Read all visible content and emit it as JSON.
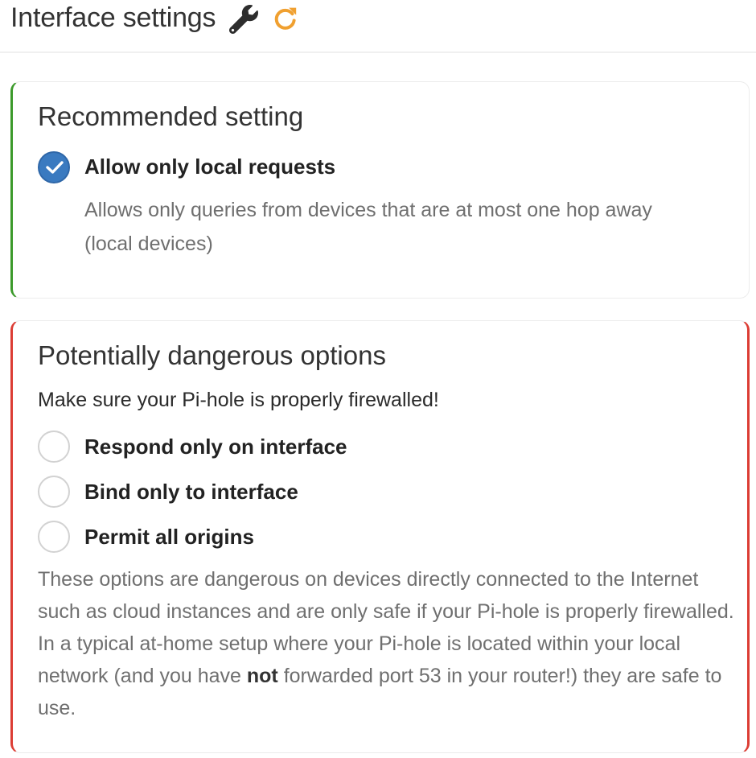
{
  "header": {
    "title": "Interface settings",
    "wrench_icon": "wrench-icon",
    "refresh_icon": "refresh-icon",
    "refresh_color": "#f0a030"
  },
  "recommended": {
    "title": "Recommended setting",
    "accent": "#3c9a2b",
    "option": {
      "label": "Allow only local requests",
      "checked": true,
      "description": "Allows only queries from devices that are at most one hop away (local devices)"
    }
  },
  "dangerous": {
    "title": "Potentially dangerous options",
    "accent": "#dc3d34",
    "warning": "Make sure your Pi-hole is properly firewalled!",
    "options": [
      {
        "label": "Respond only on interface",
        "checked": false
      },
      {
        "label": "Bind only to interface",
        "checked": false
      },
      {
        "label": "Permit all origins",
        "checked": false
      }
    ],
    "description_before": "These options are dangerous on devices directly connected to the Internet such as cloud instances and are only safe if your Pi-hole is properly firewalled. In a typical at-home setup where your Pi-hole is located within your local network (and you have ",
    "description_bold": "not",
    "description_after": " forwarded port 53 in your router!) they are safe to use."
  }
}
